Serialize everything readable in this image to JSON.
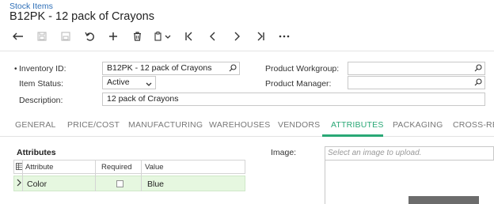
{
  "breadcrumb": "Stock Items",
  "title": "B12PK - 12 pack of Crayons",
  "toolbar": {
    "icons": [
      "back-arrow-icon",
      "save-icon",
      "save-close-icon",
      "undo-icon",
      "add-icon",
      "delete-icon",
      "copy-paste-icon",
      "first-icon",
      "previous-icon",
      "next-icon",
      "last-icon",
      "more-icon"
    ]
  },
  "form": {
    "inventory_id_label": "Inventory ID:",
    "inventory_id_value": "B12PK - 12 pack of Crayons",
    "item_status_label": "Item Status:",
    "item_status_value": "Active",
    "description_label": "Description:",
    "description_value": "12 pack of Crayons",
    "product_workgroup_label": "Product Workgroup:",
    "product_workgroup_value": "",
    "product_manager_label": "Product Manager:",
    "product_manager_value": ""
  },
  "tabs": [
    "GENERAL",
    "PRICE/COST",
    "MANUFACTURING",
    "WAREHOUSES",
    "VENDORS",
    "ATTRIBUTES",
    "PACKAGING",
    "CROSS-REF"
  ],
  "active_tab": "ATTRIBUTES",
  "attributes": {
    "title": "Attributes",
    "columns": [
      "Attribute",
      "Required",
      "Value"
    ],
    "rows": [
      {
        "attribute": "Color",
        "required": false,
        "value": "Blue"
      }
    ]
  },
  "image": {
    "label": "Image:",
    "placeholder": "Select an image to upload."
  },
  "colors": {
    "accent": "#2aa876",
    "link": "#2e6fb7",
    "selected_row": "#e6f7e0"
  }
}
